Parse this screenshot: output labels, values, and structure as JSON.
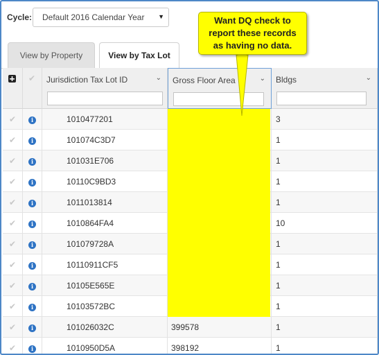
{
  "cycle": {
    "label": "Cycle:",
    "selected": "Default 2016 Calendar Year"
  },
  "tabs": [
    {
      "label": "View by Property",
      "active": false
    },
    {
      "label": "View by Tax Lot",
      "active": true
    }
  ],
  "grid": {
    "columns": [
      {
        "label": "Jurisdiction Tax Lot ID"
      },
      {
        "label": "Gross Floor Area"
      },
      {
        "label": "Bldgs"
      }
    ],
    "rows": [
      {
        "id": "1010477201",
        "gfa": "",
        "bldgs": "3"
      },
      {
        "id": "101074C3D7",
        "gfa": "",
        "bldgs": "1"
      },
      {
        "id": "101031E706",
        "gfa": "",
        "bldgs": "1"
      },
      {
        "id": "10110C9BD3",
        "gfa": "",
        "bldgs": "1"
      },
      {
        "id": "1011013814",
        "gfa": "",
        "bldgs": "1"
      },
      {
        "id": "1010864FA4",
        "gfa": "",
        "bldgs": "10"
      },
      {
        "id": "101079728A",
        "gfa": "",
        "bldgs": "1"
      },
      {
        "id": "10110911CF5",
        "gfa": "",
        "bldgs": "1"
      },
      {
        "id": "10105E565E",
        "gfa": "",
        "bldgs": "1"
      },
      {
        "id": "10103572BC",
        "gfa": "",
        "bldgs": "1"
      },
      {
        "id": "101026032C",
        "gfa": "399578",
        "bldgs": "1"
      },
      {
        "id": "1010950D5A",
        "gfa": "398192",
        "bldgs": "1"
      }
    ]
  },
  "callout": {
    "lines": [
      "Want DQ check to",
      "report these records",
      "as having no data."
    ],
    "color": "#ffff00"
  },
  "colors": {
    "frame": "#4d87c7",
    "highlight": "#ffff00",
    "info_icon": "#2e73c4"
  }
}
